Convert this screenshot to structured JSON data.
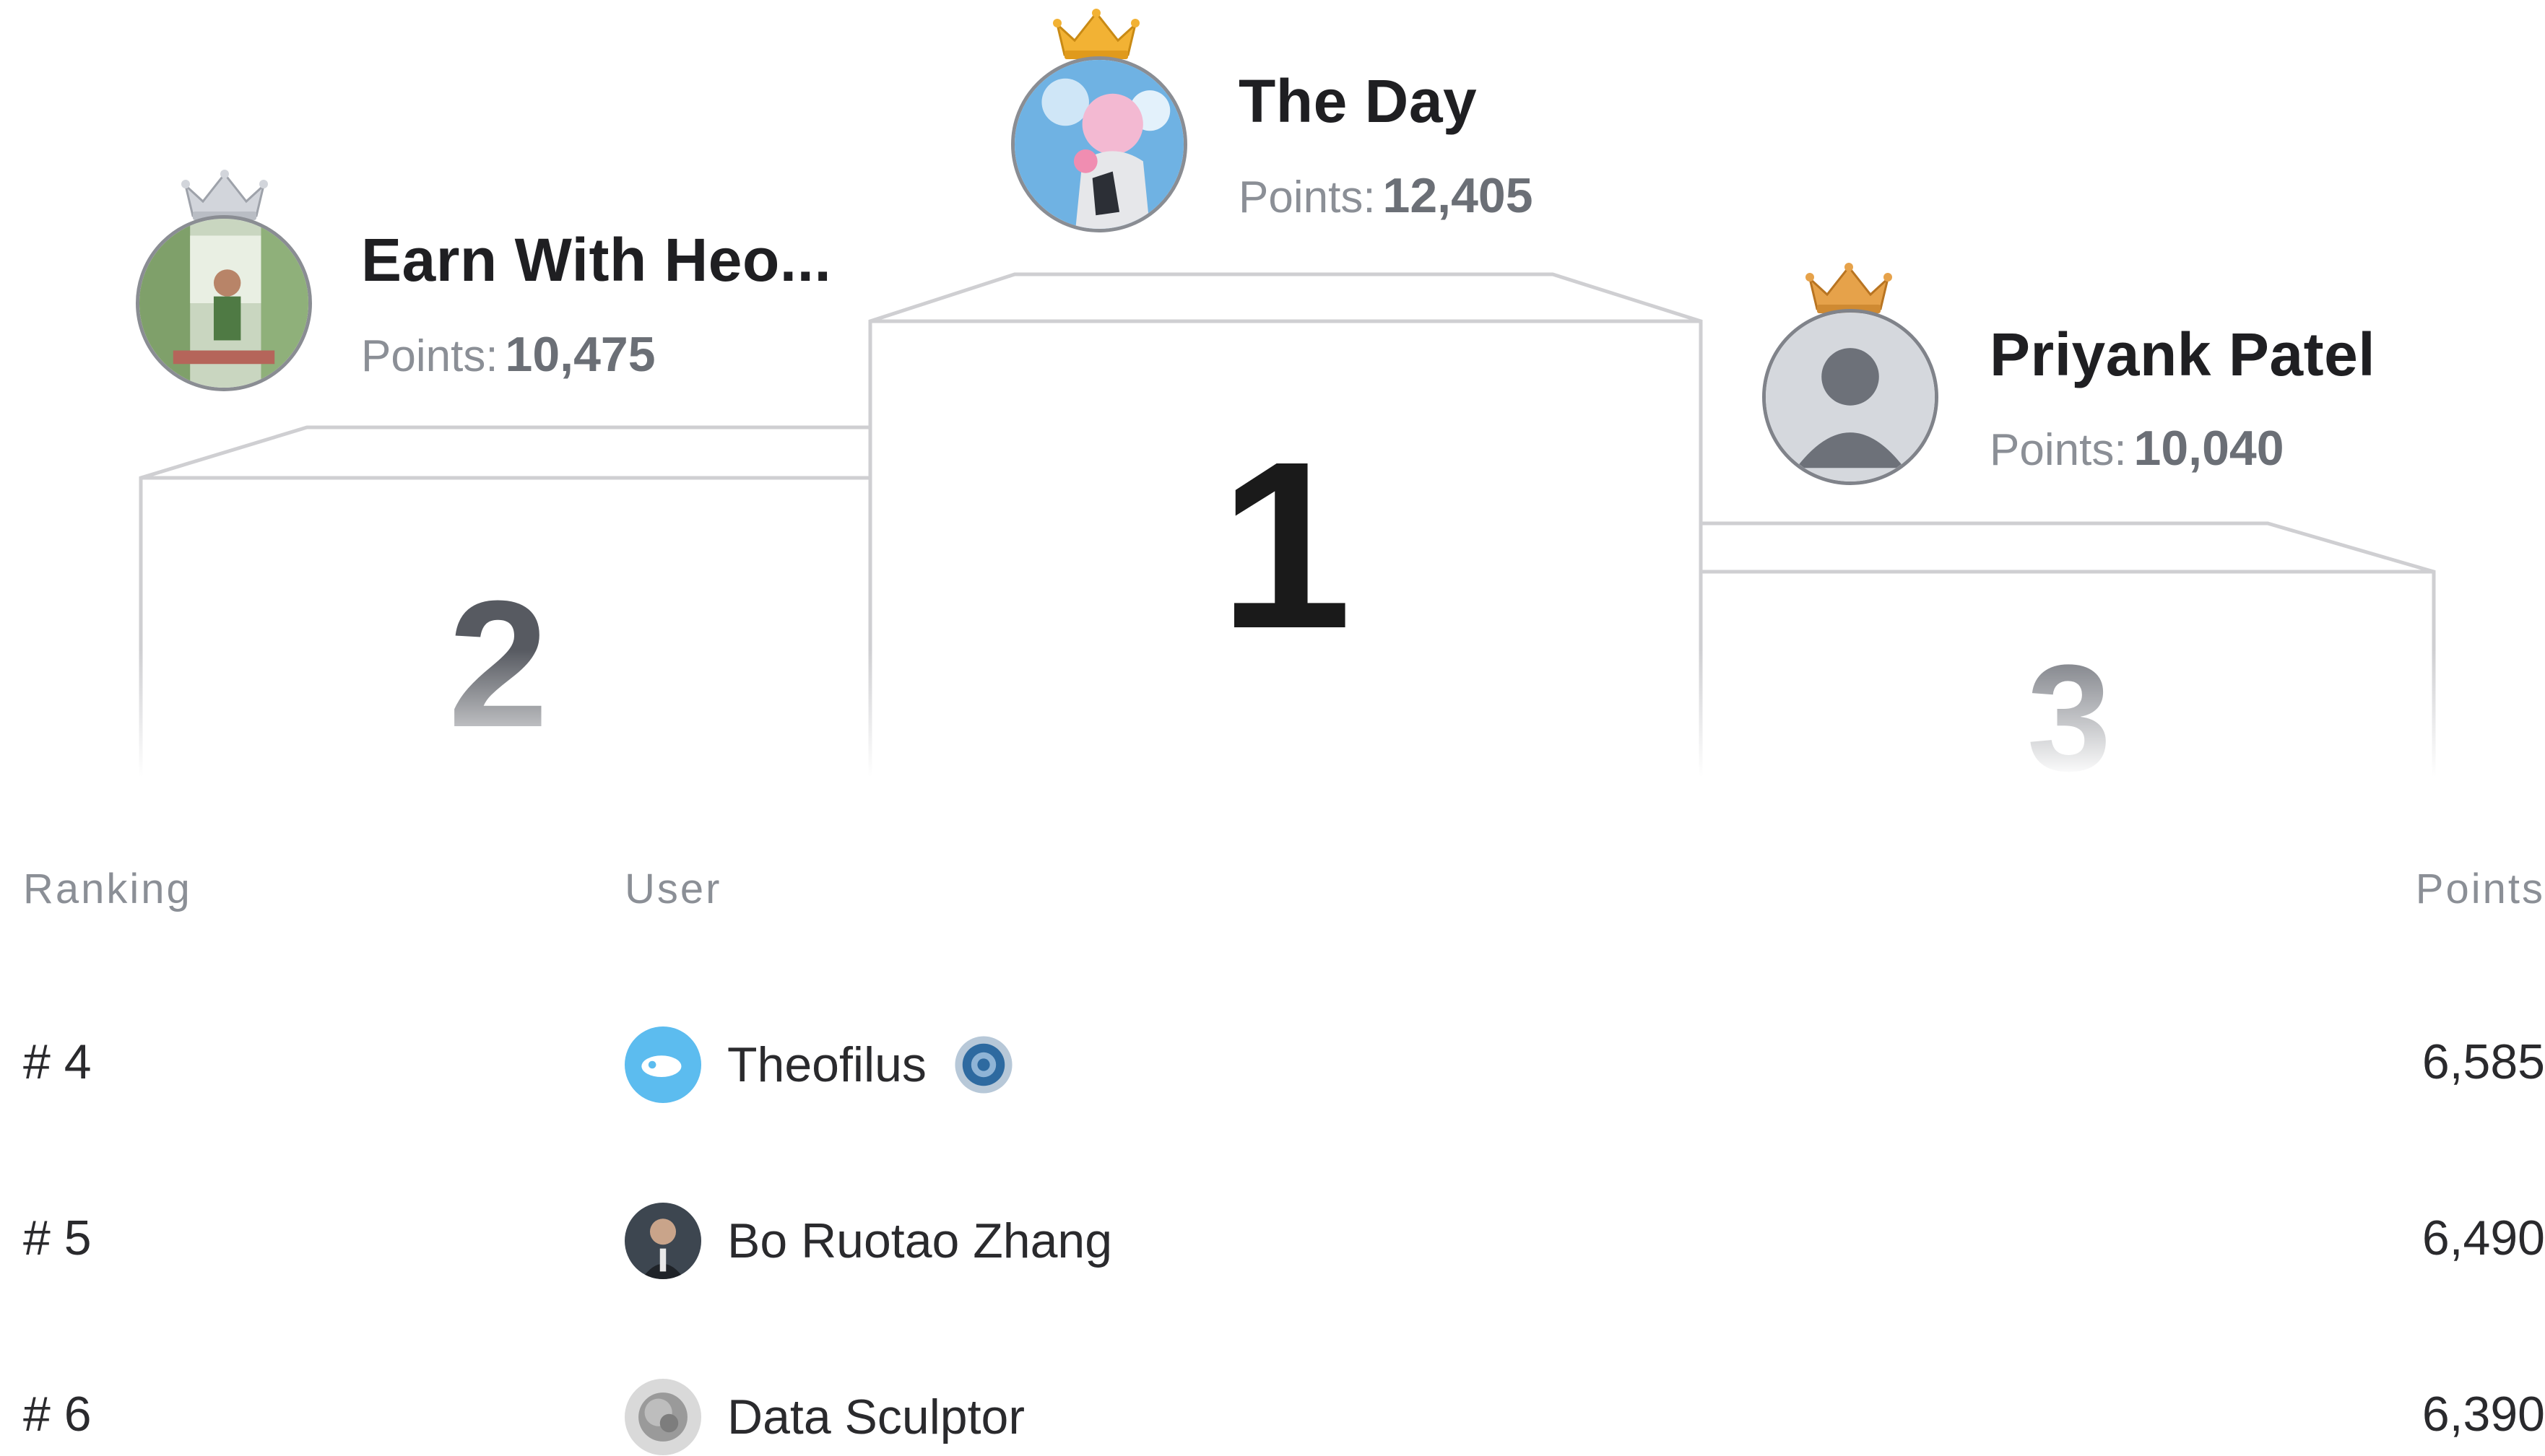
{
  "podium": {
    "first": {
      "rank": "1",
      "name": "The Day",
      "points_label": "Points:",
      "points": "12,405",
      "crown": "gold-crown-icon"
    },
    "second": {
      "rank": "2",
      "name": "Earn With Heo...",
      "points_label": "Points:",
      "points": "10,475",
      "crown": "silver-crown-icon"
    },
    "third": {
      "rank": "3",
      "name": "Priyank Patel",
      "points_label": "Points:",
      "points": "10,040",
      "crown": "bronze-crown-icon"
    }
  },
  "table": {
    "headers": {
      "ranking": "Ranking",
      "user": "User",
      "points": "Points"
    },
    "rows": [
      {
        "rank": "# 4",
        "name": "Theofilus",
        "points": "6,585",
        "badge": "verified-badge-icon"
      },
      {
        "rank": "# 5",
        "name": "Bo Ruotao Zhang",
        "points": "6,490"
      },
      {
        "rank": "# 6",
        "name": "Data Sculptor",
        "points": "6,390"
      }
    ]
  },
  "colors": {
    "gold": "#f2b234",
    "silver": "#c7cbd2",
    "bronze": "#e09a3e",
    "rank_1": "#1a1a1a",
    "rank_2": "#575a61",
    "rank_3": "#787b82"
  }
}
